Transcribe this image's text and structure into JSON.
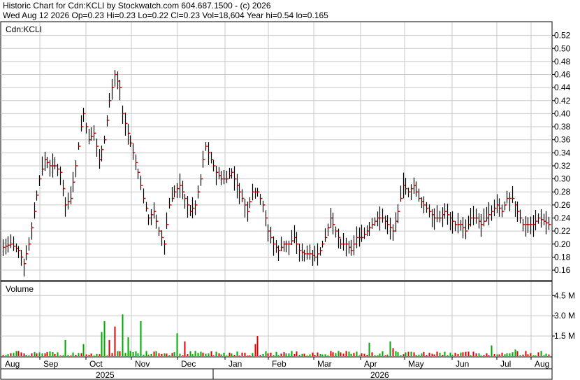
{
  "header": {
    "line1": "Historic Chart for Cdn:KCLI by Stockwatch.com 604.687.1500 - (c) 2026",
    "line2": "Wed Aug 12 2026   Op=0.23  Hi=0.23  Lo=0.22  Cl=0.23  Vol=18,604  Year hi=0.54  lo=0.165"
  },
  "chart_data": {
    "type": "ohlc_bar_with_volume",
    "symbol_label": "Cdn:KCLI",
    "volume_label": "Volume",
    "price_axis": {
      "ylim": [
        0.145,
        0.54
      ],
      "ticks": [
        "0.16",
        "0.18",
        "0.20",
        "0.22",
        "0.24",
        "0.26",
        "0.28",
        "0.30",
        "0.32",
        "0.34",
        "0.36",
        "0.38",
        "0.40",
        "0.42",
        "0.44",
        "0.46",
        "0.48",
        "0.50",
        "0.52"
      ]
    },
    "volume_axis": {
      "ylim": [
        0,
        5.5
      ],
      "unit": "M",
      "ticks": [
        "1.5 M",
        "3.0 M",
        "4.5 M"
      ]
    },
    "x_axis": {
      "months": [
        "Aug",
        "Sep",
        "Oct",
        "Nov",
        "Dec",
        "Jan",
        "Feb",
        "Mar",
        "Apr",
        "May",
        "Jun",
        "Jul",
        "Aug"
      ],
      "years": [
        "2025",
        "2026"
      ]
    },
    "colors": {
      "up_tick": "#e00000",
      "volume_up": "#00aa00",
      "volume_down": "#dd0000",
      "bar": "#000000",
      "grid": "#c8c8c8"
    },
    "price_path": [
      [
        0,
        0.195
      ],
      [
        3,
        0.2
      ],
      [
        6,
        0.19
      ],
      [
        8,
        0.17
      ],
      [
        10,
        0.2
      ],
      [
        12,
        0.25
      ],
      [
        14,
        0.3
      ],
      [
        16,
        0.33
      ],
      [
        18,
        0.32
      ],
      [
        20,
        0.32
      ],
      [
        22,
        0.31
      ],
      [
        24,
        0.26
      ],
      [
        26,
        0.27
      ],
      [
        28,
        0.32
      ],
      [
        30,
        0.38
      ],
      [
        31,
        0.4
      ],
      [
        33,
        0.36
      ],
      [
        35,
        0.37
      ],
      [
        37,
        0.33
      ],
      [
        39,
        0.36
      ],
      [
        41,
        0.42
      ],
      [
        43,
        0.46
      ],
      [
        45,
        0.44
      ],
      [
        46,
        0.4
      ],
      [
        48,
        0.37
      ],
      [
        50,
        0.34
      ],
      [
        52,
        0.31
      ],
      [
        54,
        0.27
      ],
      [
        56,
        0.24
      ],
      [
        58,
        0.25
      ],
      [
        60,
        0.22
      ],
      [
        62,
        0.2
      ],
      [
        64,
        0.26
      ],
      [
        66,
        0.28
      ],
      [
        68,
        0.29
      ],
      [
        70,
        0.27
      ],
      [
        72,
        0.25
      ],
      [
        74,
        0.26
      ],
      [
        76,
        0.3
      ],
      [
        77,
        0.33
      ],
      [
        78,
        0.35
      ],
      [
        80,
        0.33
      ],
      [
        82,
        0.31
      ],
      [
        84,
        0.3
      ],
      [
        86,
        0.3
      ],
      [
        88,
        0.31
      ],
      [
        90,
        0.29
      ],
      [
        92,
        0.27
      ],
      [
        94,
        0.25
      ],
      [
        96,
        0.28
      ],
      [
        98,
        0.28
      ],
      [
        100,
        0.26
      ],
      [
        102,
        0.22
      ],
      [
        104,
        0.2
      ],
      [
        106,
        0.19
      ],
      [
        108,
        0.2
      ],
      [
        110,
        0.2
      ],
      [
        112,
        0.21
      ],
      [
        114,
        0.19
      ],
      [
        116,
        0.185
      ],
      [
        118,
        0.185
      ],
      [
        120,
        0.18
      ],
      [
        122,
        0.19
      ],
      [
        124,
        0.21
      ],
      [
        126,
        0.24
      ],
      [
        128,
        0.22
      ],
      [
        130,
        0.2
      ],
      [
        132,
        0.2
      ],
      [
        134,
        0.19
      ],
      [
        136,
        0.21
      ],
      [
        138,
        0.21
      ],
      [
        140,
        0.22
      ],
      [
        142,
        0.23
      ],
      [
        144,
        0.24
      ],
      [
        146,
        0.24
      ],
      [
        148,
        0.23
      ],
      [
        150,
        0.22
      ],
      [
        152,
        0.25
      ],
      [
        154,
        0.29
      ],
      [
        156,
        0.28
      ],
      [
        158,
        0.29
      ],
      [
        160,
        0.27
      ],
      [
        162,
        0.26
      ],
      [
        164,
        0.25
      ],
      [
        166,
        0.24
      ],
      [
        168,
        0.24
      ],
      [
        170,
        0.25
      ],
      [
        172,
        0.24
      ],
      [
        174,
        0.23
      ],
      [
        176,
        0.23
      ],
      [
        178,
        0.22
      ],
      [
        180,
        0.24
      ],
      [
        182,
        0.24
      ],
      [
        184,
        0.23
      ],
      [
        186,
        0.24
      ],
      [
        188,
        0.25
      ],
      [
        190,
        0.26
      ],
      [
        192,
        0.25
      ],
      [
        194,
        0.27
      ],
      [
        196,
        0.27
      ],
      [
        198,
        0.25
      ],
      [
        200,
        0.23
      ],
      [
        202,
        0.23
      ],
      [
        204,
        0.23
      ],
      [
        206,
        0.24
      ],
      [
        208,
        0.235
      ],
      [
        210,
        0.23
      ]
    ],
    "volume_spikes": [
      [
        24,
        1.2,
        "g"
      ],
      [
        31,
        0.9,
        "g"
      ],
      [
        38,
        1.8,
        "g"
      ],
      [
        39,
        2.6,
        "g"
      ],
      [
        41,
        1.2,
        "r"
      ],
      [
        43,
        2.2,
        "r"
      ],
      [
        46,
        3.1,
        "g"
      ],
      [
        48,
        1.4,
        "g"
      ],
      [
        53,
        2.6,
        "g"
      ],
      [
        67,
        1.7,
        "g"
      ],
      [
        70,
        1.1,
        "r"
      ],
      [
        97,
        0.9,
        "r"
      ],
      [
        98,
        1.5,
        "r"
      ],
      [
        141,
        1.0,
        "g"
      ],
      [
        149,
        1.1,
        "g"
      ],
      [
        150,
        0.6,
        "r"
      ],
      [
        188,
        0.8,
        "g"
      ],
      [
        197,
        0.5,
        "g"
      ]
    ]
  }
}
